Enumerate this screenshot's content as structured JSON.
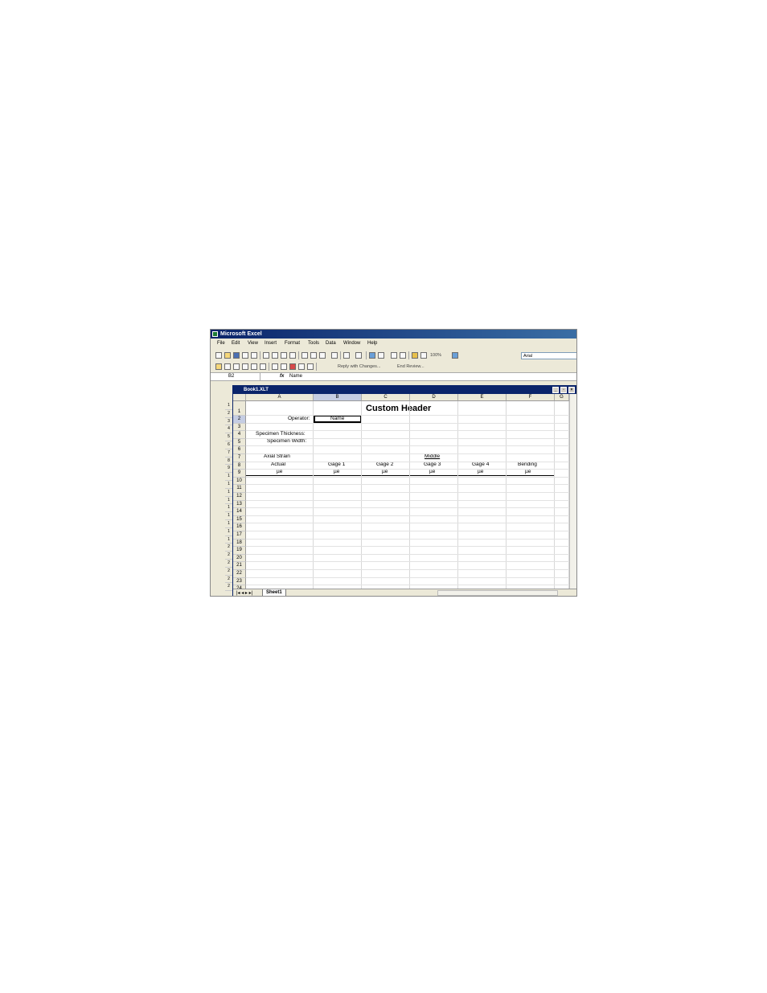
{
  "app": {
    "title": "Microsoft Excel"
  },
  "menu": [
    "File",
    "Edit",
    "View",
    "Insert",
    "Format",
    "Tools",
    "Data",
    "Window",
    "Help"
  ],
  "toolbar": {
    "zoom": "100%",
    "font": "Arial",
    "reply_with_changes": "Reply with Changes...",
    "end_review": "End Review..."
  },
  "formula_bar": {
    "name_box": "B2",
    "fx": "fx",
    "value": "Name"
  },
  "workbook": {
    "title": "Book1.XLT"
  },
  "columns": [
    "A",
    "B",
    "C",
    "D",
    "E",
    "F",
    "G"
  ],
  "rows": [
    "1",
    "2",
    "3",
    "4",
    "5",
    "6",
    "7",
    "8",
    "9",
    "10",
    "11",
    "12",
    "13",
    "14",
    "15",
    "16",
    "17",
    "18",
    "19",
    "20",
    "21",
    "22",
    "23",
    "24"
  ],
  "outer_rows": [
    "1",
    "2",
    "3",
    "4",
    "5",
    "6",
    "7",
    "8",
    "9",
    "1",
    "1",
    "1",
    "1",
    "1",
    "1",
    "1",
    "1",
    "1",
    "2",
    "2",
    "2",
    "2",
    "2",
    "2"
  ],
  "cells": {
    "title": "Custom Header",
    "operator_label": "Operator:",
    "operator_value": "Name",
    "thickness_label": "Specimen Thickness:",
    "width_label": "Specimen Width:",
    "axial_strain": "Axial Strain",
    "middle": "Middle",
    "actual": "Actual",
    "gage1": "Gage 1",
    "gage2": "Gage 2",
    "gage3": "Gage 3",
    "gage4": "Gage 4",
    "bending": "Bending",
    "unit_a": "µe",
    "unit_b": "µe",
    "unit_c": "µe",
    "unit_d": "µe",
    "unit_e": "µe",
    "unit_f": "µe"
  },
  "sheet_tab": "Sheet1"
}
